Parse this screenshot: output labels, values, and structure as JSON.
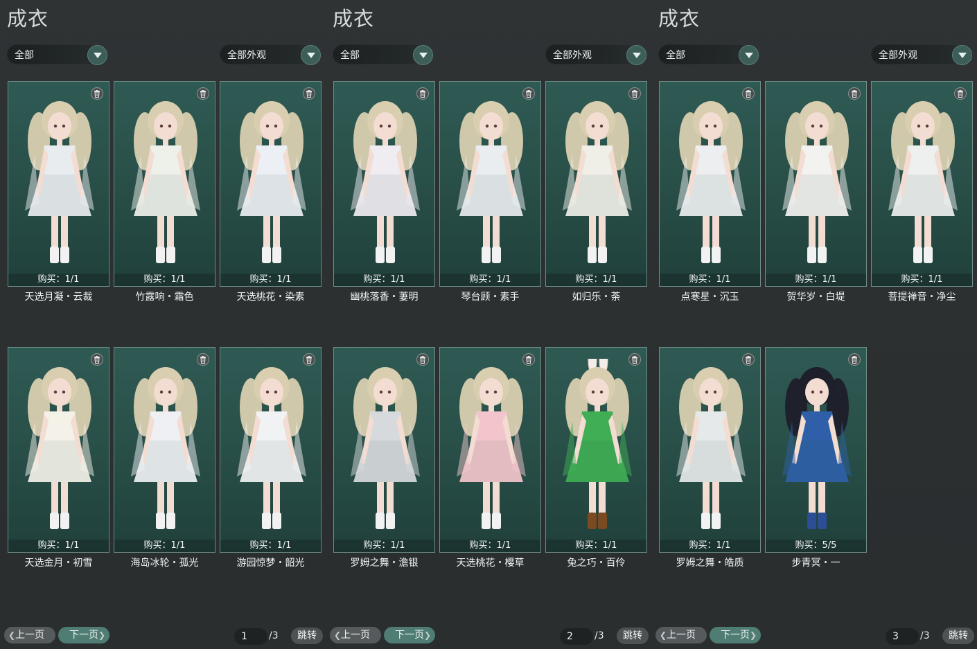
{
  "panels": [
    {
      "title": "成衣",
      "filter1": "全部",
      "filter2": "全部外观",
      "items": [
        {
          "name": "天选月凝・云裁",
          "buy": "购买：1/1"
        },
        {
          "name": "竹露响・霜色",
          "buy": "购买：1/1"
        },
        {
          "name": "天选桃花・染素",
          "buy": "购买：1/1"
        },
        {
          "name": "天选金月・初雪",
          "buy": "购买：1/1"
        },
        {
          "name": "海岛冰轮・孤光",
          "buy": "购买：1/1"
        },
        {
          "name": "游园惊梦・韶光",
          "buy": "购买：1/1"
        }
      ],
      "prev": "上一页",
      "next": "下一页",
      "page": "1",
      "total": "/3",
      "jump": "跳转"
    },
    {
      "title": "成衣",
      "filter1": "全部",
      "filter2": "全部外观",
      "items": [
        {
          "name": "幽桃落香・萋明",
          "buy": "购买：1/1"
        },
        {
          "name": "琴台顾・素手",
          "buy": "购买：1/1"
        },
        {
          "name": "如归乐・荼",
          "buy": "购买：1/1"
        },
        {
          "name": "罗姆之舞・澹银",
          "buy": "购买：1/1"
        },
        {
          "name": "天选桃花・樱草",
          "buy": "购买：1/1"
        },
        {
          "name": "兔之巧・百伶",
          "buy": "购买：1/1"
        }
      ],
      "prev": "上一页",
      "next": "下一页",
      "page": "2",
      "total": "/3",
      "jump": "跳转"
    },
    {
      "title": "成衣",
      "filter1": "全部",
      "filter2": "全部外观",
      "items": [
        {
          "name": "点寒星・沉玉",
          "buy": "购买：1/1"
        },
        {
          "name": "贺华岁・白堤",
          "buy": "购买：1/1"
        },
        {
          "name": "菩提禅音・净尘",
          "buy": "购买：1/1"
        },
        {
          "name": "罗姆之舞・皓质",
          "buy": "购买：1/1"
        },
        {
          "name": "步青冥・一",
          "buy": "购买：5/5"
        }
      ],
      "prev": "上一页",
      "next": "下一页",
      "page": "3",
      "total": "/3",
      "jump": "跳转"
    }
  ],
  "outfit_colors": [
    [
      "#e9ecef",
      "#eef0ea",
      "#eceff3",
      "#f3f1e8",
      "#eef0f4",
      "#f1f2f4"
    ],
    [
      "#efecf2",
      "#e9edef",
      "#efefe7",
      "#d7dadc",
      "#f2c5cc",
      "#3fae55"
    ],
    [
      "#eceef0",
      "#f2f2f0",
      "#eef0f0",
      "#e6e9ea",
      "#2e5fa8"
    ]
  ],
  "accent_color": "#4f7d74"
}
